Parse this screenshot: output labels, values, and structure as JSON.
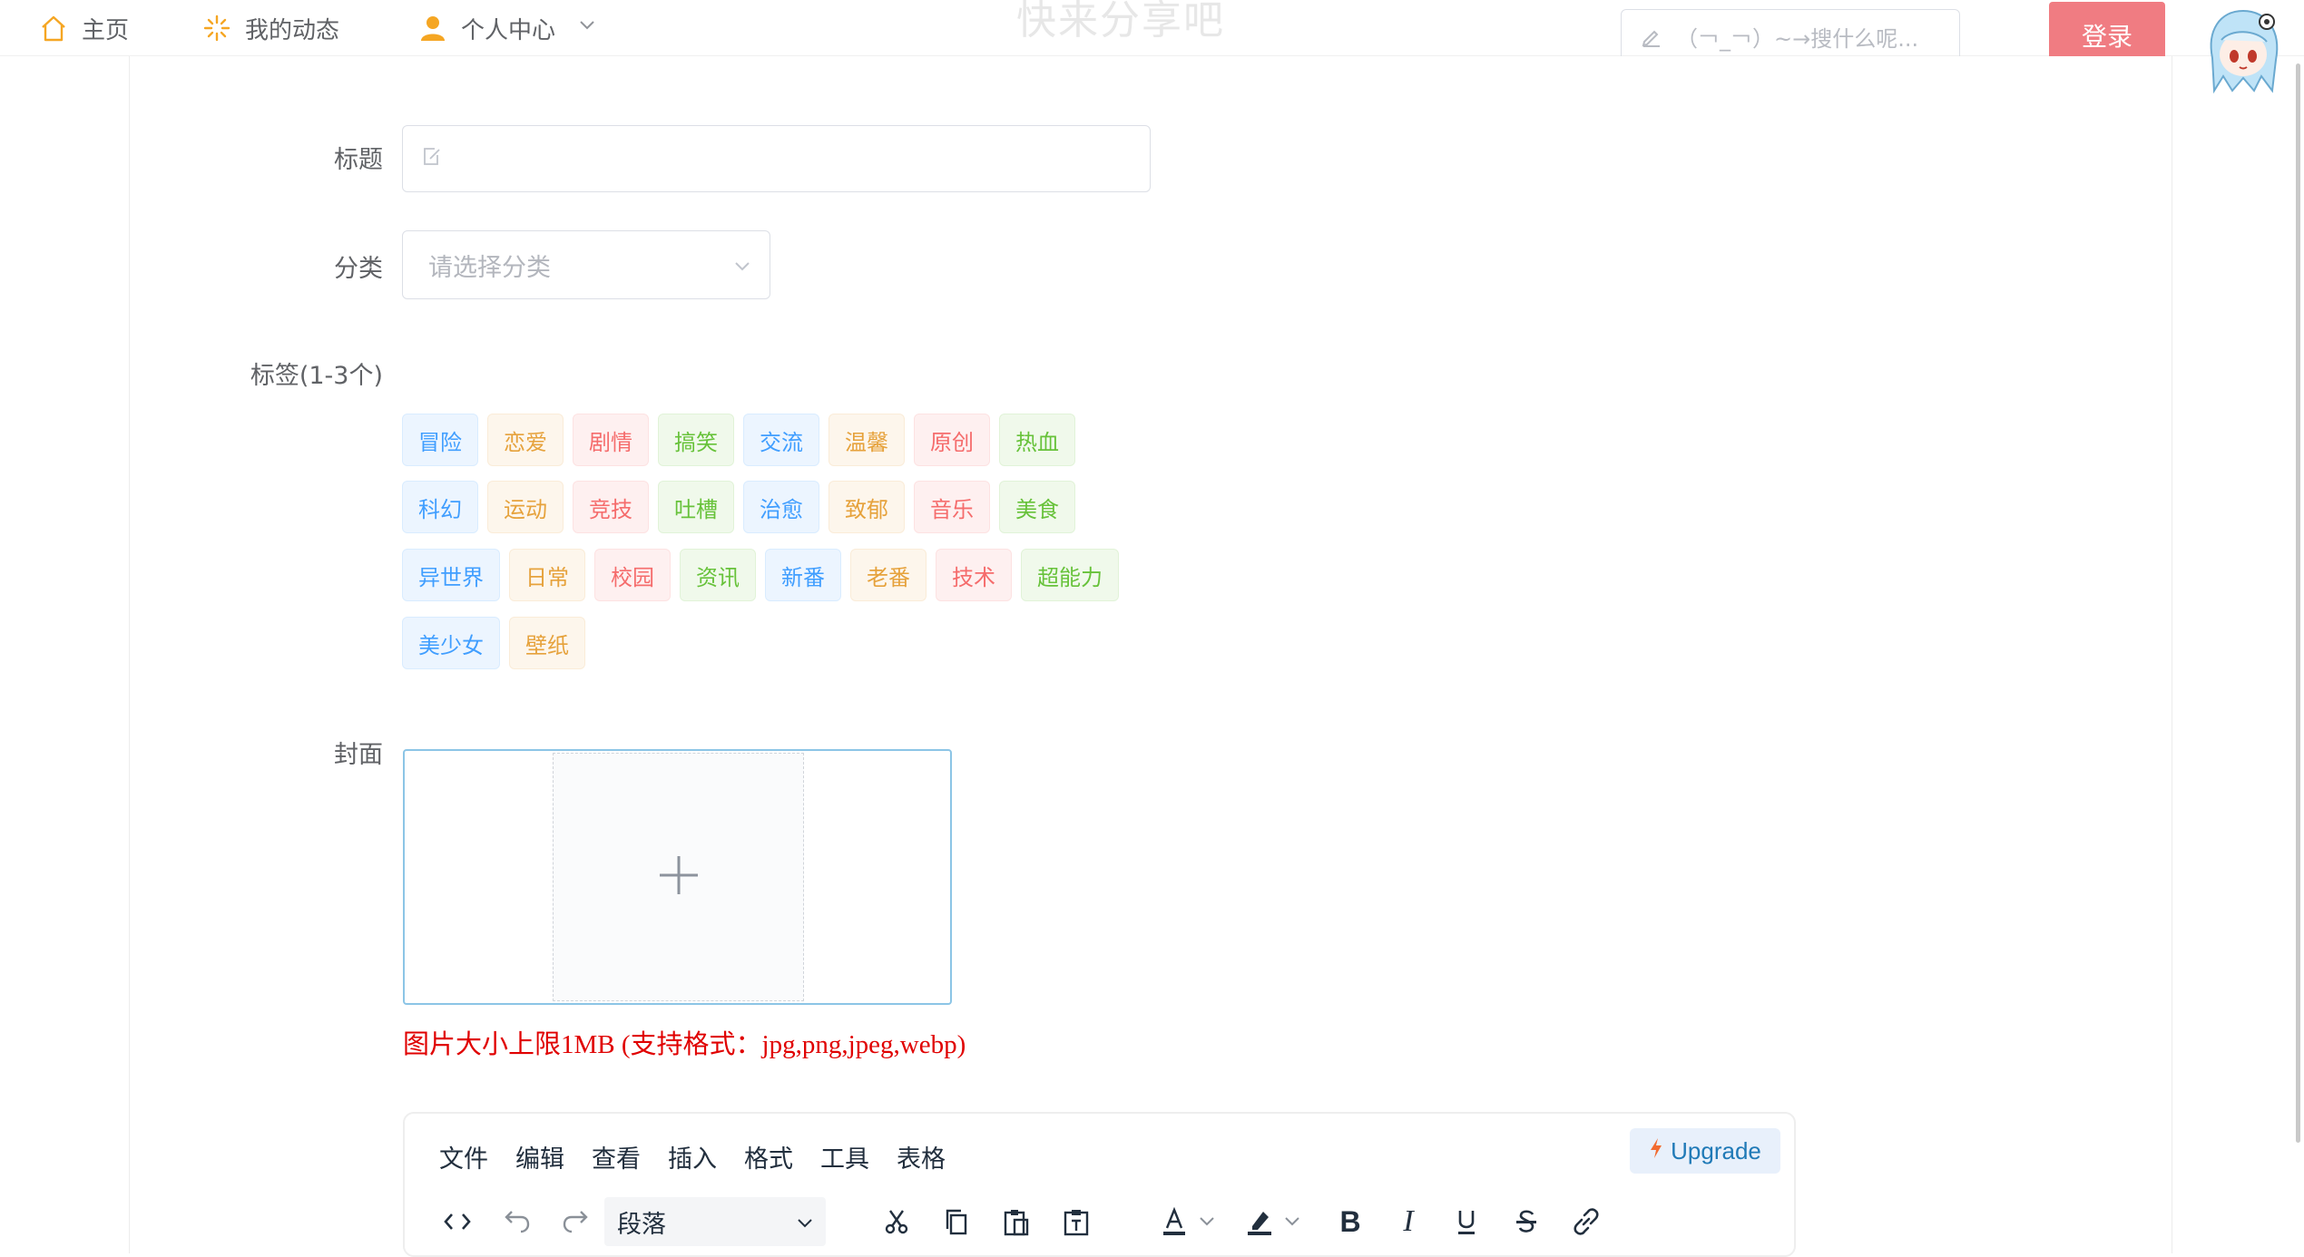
{
  "nav": {
    "home": "主页",
    "dynamics": "我的动态",
    "personal_center": "个人中心",
    "watermark": "快来分享吧"
  },
  "search": {
    "placeholder": "（￢_￢）~→搜什么呢..."
  },
  "login_label": "登录",
  "form": {
    "title_label": "标题",
    "category_label": "分类",
    "category_placeholder": "请选择分类",
    "tags_label": "标签(1-3个)",
    "cover_label": "封面",
    "cover_hint": "图片大小上限1MB (支持格式：jpg,png,jpeg,webp)"
  },
  "tags": [
    {
      "label": "冒险",
      "color": "blue"
    },
    {
      "label": "恋爱",
      "color": "orange"
    },
    {
      "label": "剧情",
      "color": "red"
    },
    {
      "label": "搞笑",
      "color": "green"
    },
    {
      "label": "交流",
      "color": "blue"
    },
    {
      "label": "温馨",
      "color": "orange"
    },
    {
      "label": "原创",
      "color": "red"
    },
    {
      "label": "热血",
      "color": "green"
    },
    {
      "label": "科幻",
      "color": "blue"
    },
    {
      "label": "运动",
      "color": "orange"
    },
    {
      "label": "竞技",
      "color": "red"
    },
    {
      "label": "吐槽",
      "color": "green"
    },
    {
      "label": "治愈",
      "color": "blue"
    },
    {
      "label": "致郁",
      "color": "orange"
    },
    {
      "label": "音乐",
      "color": "red"
    },
    {
      "label": "美食",
      "color": "green"
    },
    {
      "label": "异世界",
      "color": "blue"
    },
    {
      "label": "日常",
      "color": "orange"
    },
    {
      "label": "校园",
      "color": "red"
    },
    {
      "label": "资讯",
      "color": "green"
    },
    {
      "label": "新番",
      "color": "blue"
    },
    {
      "label": "老番",
      "color": "orange"
    },
    {
      "label": "技术",
      "color": "red"
    },
    {
      "label": "超能力",
      "color": "green"
    },
    {
      "label": "美少女",
      "color": "blue"
    },
    {
      "label": "壁纸",
      "color": "orange"
    }
  ],
  "editor": {
    "menus": [
      "文件",
      "编辑",
      "查看",
      "插入",
      "格式",
      "工具",
      "表格"
    ],
    "upgrade": "Upgrade",
    "block_format": "段落",
    "toolbar_icons": [
      "source-code-icon",
      "undo-icon",
      "redo-icon",
      "cut-icon",
      "copy-icon",
      "paste-icon",
      "paste-text-icon",
      "text-color-icon",
      "highlight-icon",
      "bold-icon",
      "italic-icon",
      "underline-icon",
      "strikethrough-icon",
      "link-icon"
    ]
  },
  "colors": {
    "login_button": "#f07c82",
    "hint_text": "#e00000",
    "uploader_border": "#8cc5e6",
    "nav_icon": "#f5a623"
  }
}
